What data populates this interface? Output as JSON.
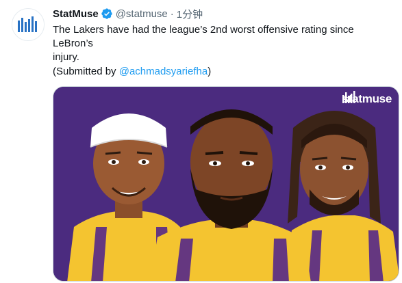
{
  "tweet": {
    "avatar_icon": "statmuse-logo-icon",
    "display_name": "StatMuse",
    "verified_icon": "verified-badge-icon",
    "handle": "@statmuse",
    "separator": "·",
    "time": "1分钟",
    "text": "The Lakers have had the league’s 2nd worst offensive rating since LeBron’s",
    "text_line2": "injury.",
    "submitted_prefix": "(Submitted by ",
    "mention": "@achmadsyariefha",
    "submitted_suffix": ")"
  },
  "media": {
    "logo_text": "statmuse",
    "background_color": "#4b2b7f",
    "jersey_color": "#f4c430",
    "trim_color": "#55288a"
  },
  "colors": {
    "accent": "#1d9bf0",
    "text": "#0f1419",
    "muted": "#536471",
    "brand_blue": "#2872c4"
  }
}
